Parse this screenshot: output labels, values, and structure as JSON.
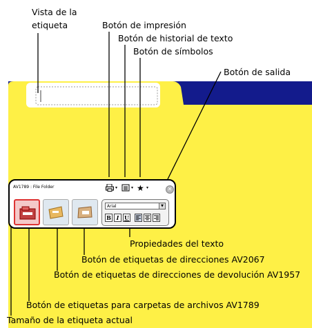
{
  "callouts": {
    "label_view": "Vista de la etiqueta",
    "print_button": "Botón de impresión",
    "text_history_button": "Botón de historial de texto",
    "symbols_button": "Botón de símbolos",
    "exit_button": "Botón de salida",
    "text_properties": "Propiedades del texto",
    "address_labels_button": "Botón de etiquetas de direcciones AV2067",
    "return_address_labels_button": "Botón de etiquetas de direcciones de devolución AV1957",
    "file_folder_labels_button": "Botón de etiquetas para carpetas de archivos AV1789",
    "current_label_size": "Tamaño de la etiqueta actual"
  },
  "panel": {
    "title": "AV1789 : File Folder",
    "print_icon": "printer-icon",
    "history_icon": "text-history-icon",
    "symbol_icon": "star-icon",
    "close_icon": "close-icon",
    "font_value": "Arial",
    "bold": "B",
    "italic": "I",
    "underline": "U"
  },
  "colors": {
    "folder_yellow": "#fef046",
    "folder_tab_band": "#131b8c",
    "selected_label": "#d33333"
  }
}
